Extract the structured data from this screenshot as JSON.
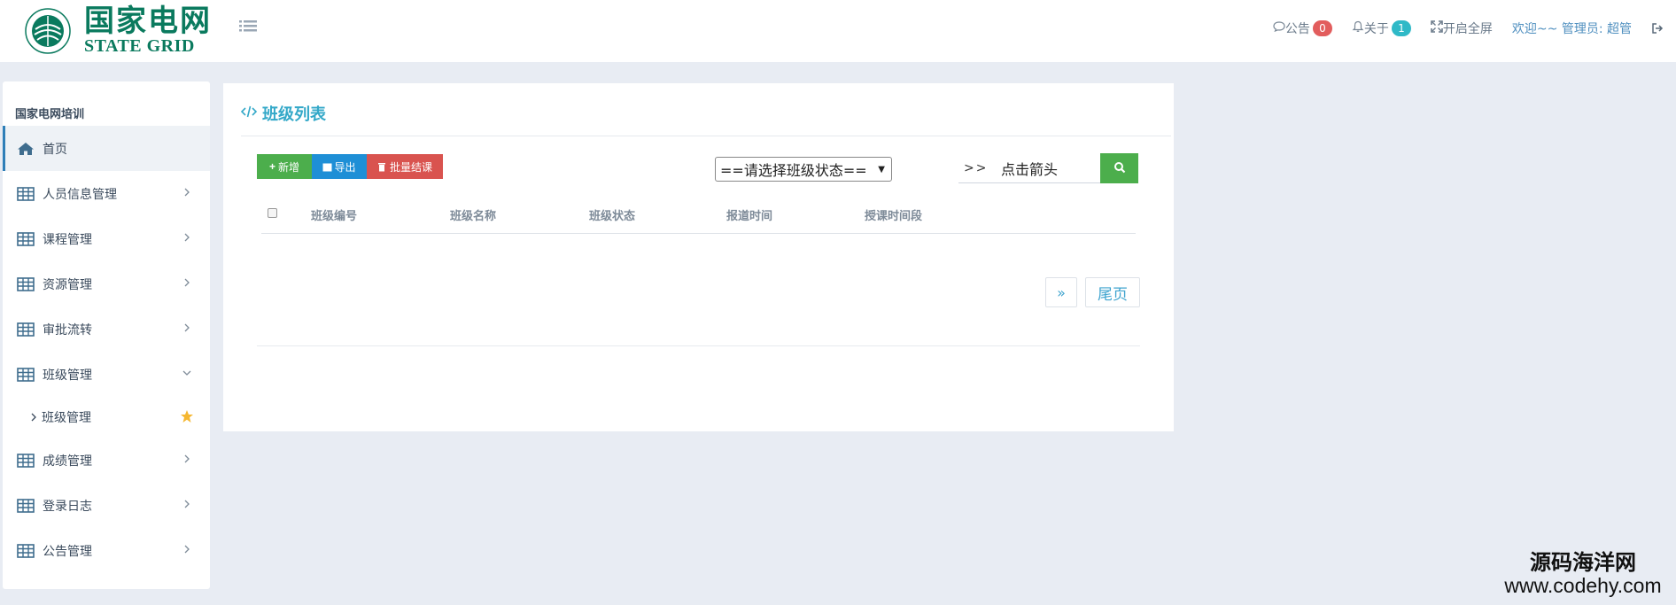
{
  "logo": {
    "cn": "国家电网",
    "en": "STATE GRID"
  },
  "topnav": {
    "notice_label": "公告",
    "notice_count": "0",
    "about_label": "关于",
    "about_count": "1",
    "fullscreen_label": "开启全屏",
    "welcome": "欢迎~~ 管理员: 超管"
  },
  "sidebar": {
    "title": "国家电网培训",
    "items": [
      {
        "label": "首页"
      },
      {
        "label": "人员信息管理"
      },
      {
        "label": "课程管理"
      },
      {
        "label": "资源管理"
      },
      {
        "label": "审批流转"
      },
      {
        "label": "班级管理"
      },
      {
        "label": "成绩管理"
      },
      {
        "label": "登录日志"
      },
      {
        "label": "公告管理"
      }
    ],
    "sub_items": [
      {
        "label": "班级管理"
      }
    ]
  },
  "panel": {
    "title": "班级列表",
    "add_label": "新增",
    "export_label": "导出",
    "batch_label": "批量结课",
    "status_select": "==请选择班级状态==",
    "search_prefix": ">>",
    "search_value": "点击箭头",
    "columns": [
      "班级编号",
      "班级名称",
      "班级状态",
      "报道时间",
      "授课时间段"
    ],
    "pager_next": "»",
    "pager_last": "尾页"
  },
  "watermark": {
    "cn": "源码海洋网",
    "url": "www.codehy.com"
  },
  "colors": {
    "brand": "#0a7a5e",
    "accent": "#33a8c8",
    "green": "#4cae4c",
    "blue": "#1e8fd6",
    "red": "#d9534f"
  }
}
